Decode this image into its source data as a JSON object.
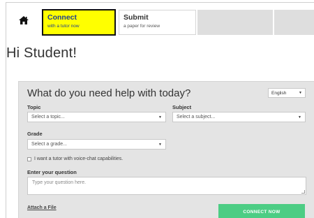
{
  "nav": {
    "tabs": [
      {
        "title": "Connect",
        "subtitle": "with a tutor now"
      },
      {
        "title": "Submit",
        "subtitle": "a paper for review"
      }
    ],
    "home_icon": "home-icon"
  },
  "greeting": "Hi Student!",
  "form": {
    "heading": "What do you need help with today?",
    "language": "English",
    "topic": {
      "label": "Topic",
      "value": "Select a topic..."
    },
    "subject": {
      "label": "Subject",
      "value": "Select a subject..."
    },
    "grade": {
      "label": "Grade",
      "value": "Select a grade..."
    },
    "voice_chat_label": "I want a tutor with voice-chat capabilities.",
    "question": {
      "label": "Enter your question",
      "placeholder": "Type your question here."
    },
    "attach_label": "Attach a File",
    "submit_label": "CONNECT NOW"
  },
  "colors": {
    "connect_tab_bg": "#ffff00",
    "connect_btn_bg": "#4ccd84",
    "panel_bg": "#e4e4e4"
  }
}
